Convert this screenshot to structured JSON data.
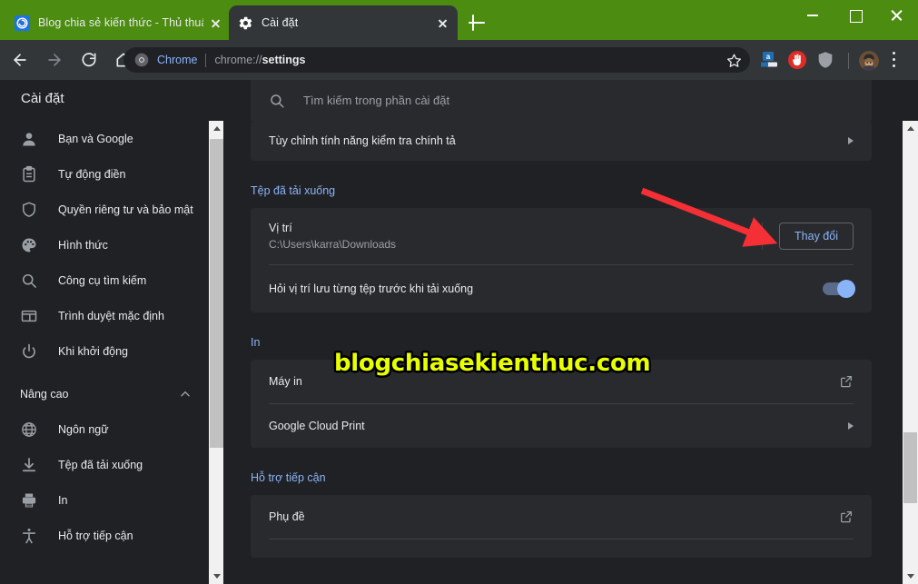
{
  "window": {
    "titlebar_color": "#4c8c10",
    "controls": [
      {
        "name": "minimize",
        "label": "Thu nhỏ"
      },
      {
        "name": "maximize",
        "label": "Phóng to"
      },
      {
        "name": "close",
        "label": "Đóng"
      }
    ]
  },
  "tabs": [
    {
      "title": "Blog chia sẻ kiến thức - Thủ thuậ",
      "favicon": "blog-favicon",
      "active": false
    },
    {
      "title": "Cài đặt",
      "favicon": "gear-icon",
      "active": true
    }
  ],
  "new_tab_label": "+",
  "toolbar": {
    "back_label": "Quay lại",
    "forward_label": "Chuyển tiếp",
    "reload_label": "Tải lại",
    "home_label": "Trang chủ",
    "omnibox": {
      "chip_label": "Chrome",
      "url_prefix": "chrome://",
      "url_bold": "settings"
    },
    "bookmark_label": "Dấu trang",
    "extensions": [
      {
        "name": "amazon-assistant-icon",
        "color": "#146eb4"
      },
      {
        "name": "adblock-icon",
        "color": "#e02c26"
      },
      {
        "name": "shield-extension-icon",
        "color": "#9aa0a6"
      }
    ],
    "profile_label": "Hồ sơ",
    "menu_label": "Tùy chỉnh và kiểm soát Google Chrome"
  },
  "settings": {
    "title": "Cài đặt",
    "search_placeholder": "Tìm kiếm trong phần cài đặt",
    "search_value": ""
  },
  "sidebar": {
    "items": [
      {
        "label": "Bạn và Google",
        "icon": "person-icon"
      },
      {
        "label": "Tự động điền",
        "icon": "clipboard-icon"
      },
      {
        "label": "Quyền riêng tư và bảo mật",
        "icon": "shield-icon"
      },
      {
        "label": "Hình thức",
        "icon": "palette-icon"
      },
      {
        "label": "Công cụ tìm kiếm",
        "icon": "search-icon"
      },
      {
        "label": "Trình duyệt mặc định",
        "icon": "browser-icon"
      },
      {
        "label": "Khi khởi động",
        "icon": "power-icon"
      }
    ],
    "advanced_group": {
      "label": "Nâng cao",
      "expanded": true,
      "items": [
        {
          "label": "Ngôn ngữ",
          "icon": "globe-icon"
        },
        {
          "label": "Tệp đã tải xuống",
          "icon": "download-icon"
        },
        {
          "label": "In",
          "icon": "printer-icon"
        },
        {
          "label": "Hỗ trợ tiếp cận",
          "icon": "accessibility-icon"
        }
      ]
    }
  },
  "main": {
    "spellcheck_row": {
      "label": "Tùy chỉnh tính năng kiểm tra chính tả",
      "action": "chevron-right-icon"
    },
    "downloads": {
      "section_title": "Tệp đã tải xuống",
      "location_label": "Vị trí",
      "location_value": "C:\\Users\\karra\\Downloads",
      "change_button": "Thay đổi",
      "ask_label": "Hỏi vị trí lưu từng tệp trước khi tải xuống",
      "ask_toggle_on": true
    },
    "print": {
      "section_title": "In",
      "rows": [
        {
          "label": "Máy in",
          "action": "external-link-icon"
        },
        {
          "label": "Google Cloud Print",
          "action": "chevron-right-icon"
        }
      ]
    },
    "accessibility": {
      "section_title": "Hỗ trợ tiếp cận",
      "rows": [
        {
          "label": "Phụ đề",
          "action": "external-link-icon"
        }
      ]
    }
  },
  "annotation": {
    "watermark": "blogchiasekienthuc.com",
    "watermark_color": "#e8ff00",
    "arrow_color": "#f42f35"
  }
}
